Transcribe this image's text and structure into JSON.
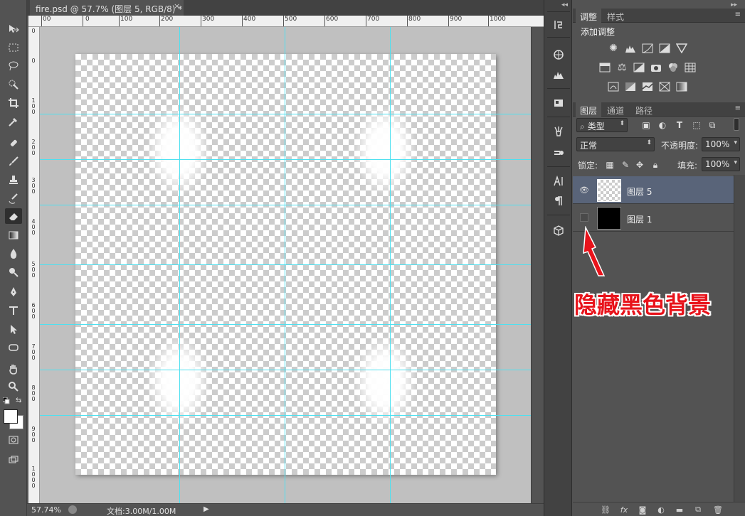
{
  "document": {
    "tab_title": "fire.psd @ 57.7% (图层 5, RGB/8) *",
    "close_glyph": "×"
  },
  "rulers": {
    "top_ticks": [
      "00",
      "0",
      "100",
      "200",
      "300",
      "400",
      "500",
      "600",
      "700",
      "800",
      "900",
      "1000"
    ],
    "left_ticks": [
      "0",
      "0",
      "100",
      "200",
      "300",
      "400",
      "500",
      "600",
      "700",
      "800",
      "900",
      "1000"
    ]
  },
  "status": {
    "zoom": "57.74%",
    "doc_size": "文档:3.00M/1.00M"
  },
  "adjustments_panel": {
    "tabs": [
      "调整",
      "样式"
    ],
    "heading": "添加调整"
  },
  "layers_panel": {
    "tabs": [
      "图层",
      "通道",
      "路径"
    ],
    "filter_label": "类型",
    "blend_mode": "正常",
    "opacity_label": "不透明度:",
    "opacity_value": "100%",
    "lock_label": "锁定:",
    "fill_label": "填充:",
    "fill_value": "100%",
    "layers": [
      {
        "name": "图层 5",
        "visible": true,
        "selected": true,
        "thumb": "transparent"
      },
      {
        "name": "图层 1",
        "visible": false,
        "selected": false,
        "thumb": "black"
      }
    ]
  },
  "annotation": {
    "text": "隐藏黑色背景",
    "color": "#e8131b"
  },
  "colors": {
    "guide": "#4ee0f0",
    "selected_layer": "#596479",
    "panel_bg": "#535353"
  }
}
